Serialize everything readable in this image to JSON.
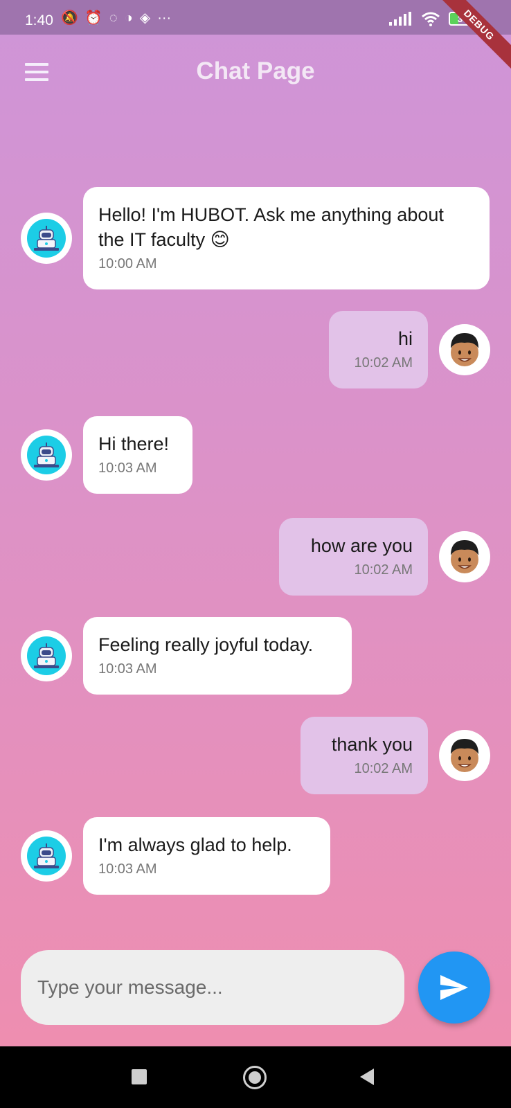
{
  "status_bar": {
    "time": "1:40",
    "battery": "34",
    "debug_label": "DEBUG",
    "more": "···"
  },
  "app_bar": {
    "title": "Chat Page"
  },
  "messages": [
    {
      "sender": "bot",
      "text": "Hello! I'm HUBOT. Ask me anything about the IT faculty 😊",
      "time": "10:00 AM"
    },
    {
      "sender": "user",
      "text": "hi",
      "time": "10:02 AM"
    },
    {
      "sender": "bot",
      "text": "Hi there!",
      "time": "10:03 AM"
    },
    {
      "sender": "user",
      "text": "how are you",
      "time": "10:02 AM"
    },
    {
      "sender": "bot",
      "text": "Feeling really joyful today.",
      "time": "10:03 AM"
    },
    {
      "sender": "user",
      "text": "thank you",
      "time": "10:02 AM"
    },
    {
      "sender": "bot",
      "text": "I'm always glad to help.",
      "time": "10:03 AM"
    }
  ],
  "input": {
    "placeholder": "Type your message...",
    "value": ""
  },
  "colors": {
    "send_button": "#2196f3",
    "user_bubble": "#e2c2e8",
    "bot_bubble": "#ffffff"
  }
}
